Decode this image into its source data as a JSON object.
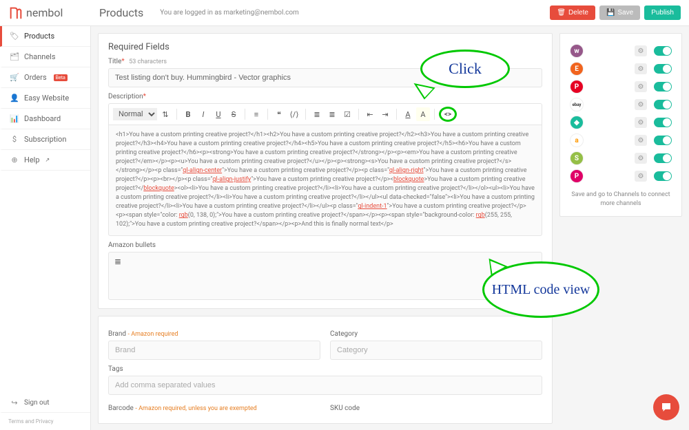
{
  "brand": "nembol",
  "page_title": "Products",
  "login_text": "You are logged in as marketing@nembol.com",
  "actions": {
    "delete": "Delete",
    "save": "Save",
    "publish": "Publish"
  },
  "sidebar": {
    "items": [
      {
        "label": "Products",
        "icon": "🏷"
      },
      {
        "label": "Channels",
        "icon": "🗂"
      },
      {
        "label": "Orders",
        "icon": "🛒",
        "beta": "Beta"
      },
      {
        "label": "Easy Website",
        "icon": "👤"
      },
      {
        "label": "Dashboard",
        "icon": "📊"
      },
      {
        "label": "Subscription",
        "icon": "$"
      },
      {
        "label": "Help",
        "icon": "⊕"
      }
    ],
    "signout": "Sign out",
    "terms": "Terms and Privacy"
  },
  "required_section": {
    "title": "Required Fields",
    "title_label": "Title",
    "title_charcount": "53 characters",
    "title_value": "Test listing don't buy. Hummingbird - Vector graphics",
    "description_label": "Description",
    "toolbar": {
      "format_select": "Normal"
    },
    "editor_html": "<h1>You have a custom printing creative project?</h1><h2>You have a custom printing creative project?</h2><h3>You have a custom printing creative project?</h3><h4>You have a custom printing creative project?</h4><h5>You have a custom printing creative project?</h5><h6>You have a custom printing creative project?</h6><p><strong>You have a custom printing creative project?</strong></p><p><em>You have a custom printing creative project?</em></p><p><u>You have a custom printing creative project?</u></p><p><strong><s>You have a custom printing creative project?</s></strong></p><p class=\"ql-align-center\">You have a custom printing creative project?</p><p class=\"ql-align-right\">You have a custom printing creative project?</p><p><br></p><p class=\"ql-align-justify\">You have a custom printing creative project?</p><blockquote>You have a custom printing creative project?</blockquote><ol><li>You have a custom printing creative project?</li><li>You have a custom printing creative project?</li></ol><ul><li>You have a custom printing creative project?</li><li>You have a custom printing creative project?</li></ul><ul data-checked=\"false\"><li>You have a custom printing creative project?</li><li>You have a custom printing creative project?</li></ul><p class=\"ql-indent-1\">You have a custom printing creative project?</p><p><span style=\"color: rgb(0, 138, 0);\">You have a custom printing creative project?</span></p><p><span style=\"background-color: rgb(255, 255, 102);\">You have a custom printing creative project?</span></p><p>And this is finally normal text</p>",
    "amazon_bullets_label": "Amazon bullets"
  },
  "details_section": {
    "brand_label": "Brand",
    "brand_req": "- Amazon required",
    "brand_ph": "Brand",
    "category_label": "Category",
    "category_ph": "Category",
    "tags_label": "Tags",
    "tags_ph": "Add comma separated values",
    "barcode_label": "Barcode",
    "barcode_req": "- Amazon required, unless you are exempted",
    "sku_label": "SKU code"
  },
  "channels": {
    "items": [
      {
        "name": "woocommerce",
        "bg": "#96588a",
        "glyph": "w"
      },
      {
        "name": "etsy",
        "bg": "#f1641e",
        "glyph": "E"
      },
      {
        "name": "pinterest",
        "bg": "#e60023",
        "glyph": "P"
      },
      {
        "name": "ebay",
        "bg": "#ffffff",
        "glyph": "ebay",
        "fg": "#333"
      },
      {
        "name": "tag",
        "bg": "#1abc9c",
        "glyph": "◆"
      },
      {
        "name": "amazon",
        "bg": "#ffffff",
        "glyph": "a",
        "fg": "#ff9900"
      },
      {
        "name": "shopify",
        "bg": "#95bf47",
        "glyph": "S"
      },
      {
        "name": "prestashop",
        "bg": "#df0067",
        "glyph": "P"
      }
    ],
    "hint": "Save and go to Channels to connect more channels"
  },
  "callouts": {
    "click": "Click",
    "codeview": "HTML code view"
  }
}
